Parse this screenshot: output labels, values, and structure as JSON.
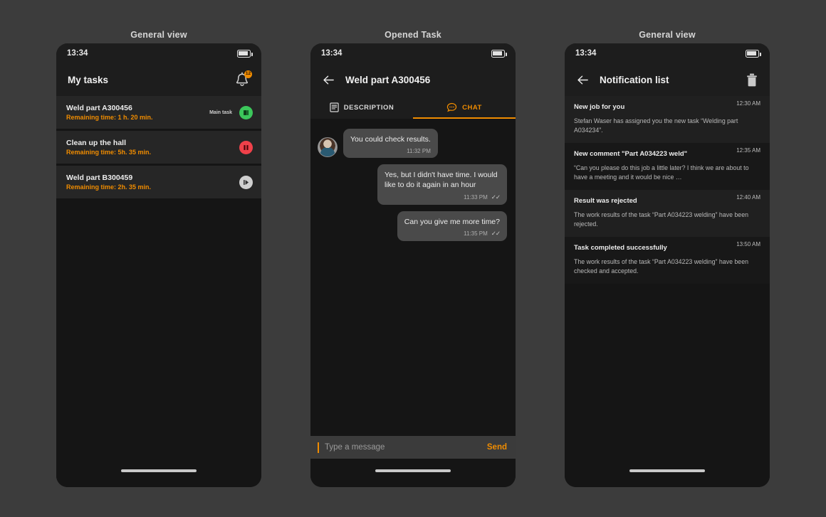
{
  "panels": [
    {
      "caption": "General view"
    },
    {
      "caption": "Opened Task"
    },
    {
      "caption": "General view"
    }
  ],
  "status_bar": {
    "time": "13:34",
    "battery_icon": "battery-icon"
  },
  "screen_tasks": {
    "appbar": {
      "title": "My tasks",
      "bell_icon": "bell-icon",
      "badge": "12"
    },
    "tasks": [
      {
        "title": "Weld part A300456",
        "remaining": "Remaining time: 1 h. 20 min.",
        "tag": "Main task",
        "action_icon": "stop-icon",
        "action_color": "#3cc75b"
      },
      {
        "title": "Clean up the hall",
        "remaining": "Remaining time: 5h. 35 min.",
        "tag": "",
        "action_icon": "pause-icon",
        "action_color": "#f0414a"
      },
      {
        "title": "Weld part B300459",
        "remaining": "Remaining time: 2h. 35 min.",
        "tag": "",
        "action_icon": "play-icon",
        "action_color": "#cfcfcf"
      }
    ]
  },
  "screen_task": {
    "appbar": {
      "title": "Weld part A300456",
      "back_icon": "back-arrow-icon"
    },
    "tabs": [
      {
        "label": "DESCRIPTION",
        "icon": "document-icon",
        "active": false
      },
      {
        "label": "CHAT",
        "icon": "chat-bubble-icon",
        "active": true
      }
    ],
    "messages": [
      {
        "side": "in",
        "text": "You could check results.",
        "time": "11:32 PM",
        "ticks": "",
        "avatar": "user-avatar"
      },
      {
        "side": "out",
        "text": "Yes, but I didn't have time. I would like to do it again in an hour",
        "time": "11:33 PM",
        "ticks": "✓✓"
      },
      {
        "side": "out",
        "text": "Can you give me more time?",
        "time": "11:35 PM",
        "ticks": "✓✓"
      }
    ],
    "composer": {
      "placeholder": "Type a message",
      "value": "",
      "send_label": "Send"
    }
  },
  "screen_notifications": {
    "appbar": {
      "title": "Notification list",
      "back_icon": "back-arrow-icon",
      "delete_icon": "trash-icon"
    },
    "items": [
      {
        "title": "New job for you",
        "time": "12:30 AM",
        "text": "Stefan Waser has assigned you the new task “Welding part A034234”."
      },
      {
        "title": "New comment \"Part A034223 weld\"",
        "time": "12:35 AM",
        "text": "“Can you please do this job a little later? I think we are about to have a meeting and it would be nice …"
      },
      {
        "title": "Result was rejected",
        "time": "12:40 AM",
        "text": "The work results of the task “Part A034223 welding” have been rejected."
      },
      {
        "title": "Task completed successfully",
        "time": "13:50 AM",
        "text": "The work results of the task “Part A034223 welding” have been checked and accepted."
      }
    ]
  },
  "colors": {
    "accent": "#f08c00",
    "background": "#3c3c3c",
    "screen": "#151515",
    "surface": "#262626",
    "green": "#3cc75b",
    "red": "#f0414a"
  }
}
